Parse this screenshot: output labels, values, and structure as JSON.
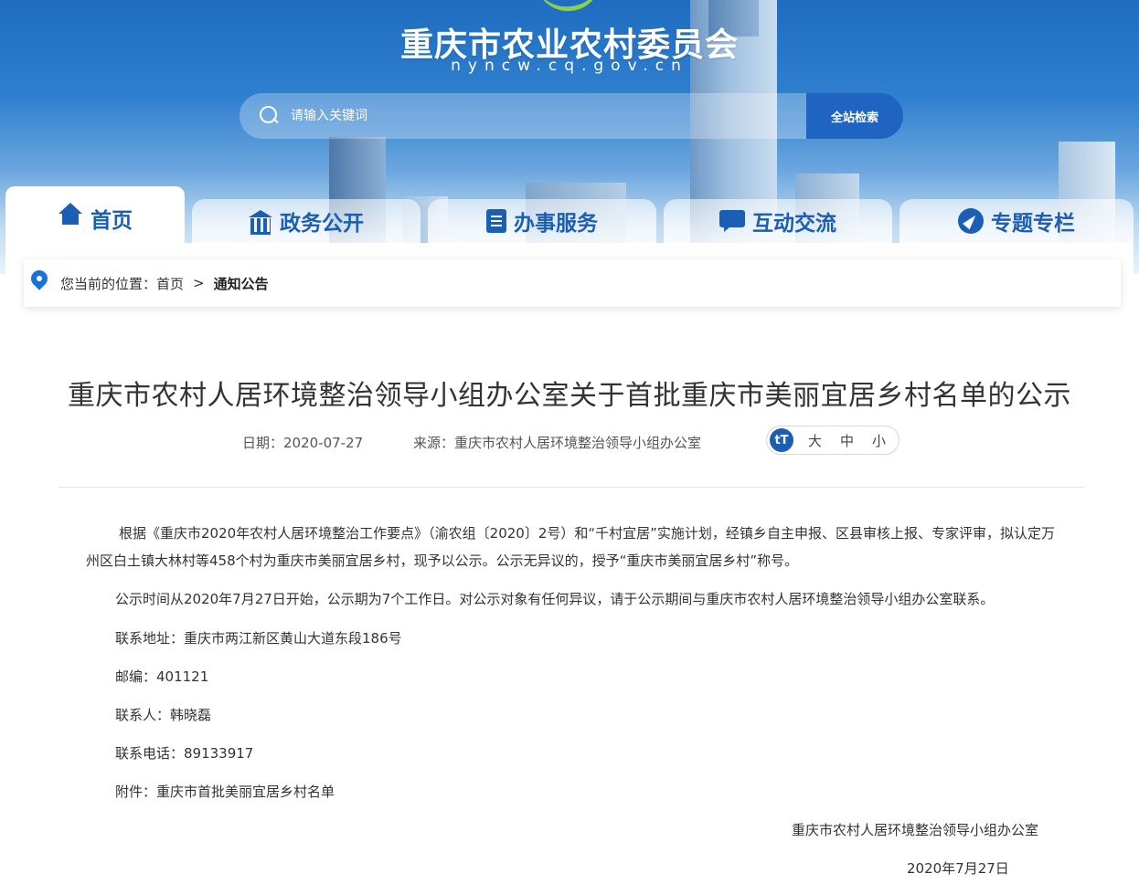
{
  "header": {
    "site_title": "重庆市农业农村委员会",
    "site_domain": "nyncw.cq.gov.cn",
    "search": {
      "placeholder": "请输入关键词",
      "button_label": "全站检索"
    }
  },
  "nav": {
    "items": [
      {
        "label": "首页",
        "icon": "home-icon",
        "active": true
      },
      {
        "label": "政务公开",
        "icon": "government-building-icon",
        "active": false
      },
      {
        "label": "办事服务",
        "icon": "service-checklist-icon",
        "active": false
      },
      {
        "label": "互动交流",
        "icon": "chat-icon",
        "active": false
      },
      {
        "label": "专题专栏",
        "icon": "compass-icon",
        "active": false
      }
    ]
  },
  "breadcrumb": {
    "prefix": "您当前的位置：",
    "home": "首页",
    "separator": ">",
    "current": "通知公告"
  },
  "article": {
    "title": "重庆市农村人居环境整治领导小组办公室关于首批重庆市美丽宜居乡村名单的公示",
    "date": "日期：2020-07-27",
    "source": "来源：重庆市农村人居环境整治领导小组办公室",
    "font_size": {
      "icon_text": "tT",
      "large": "大",
      "medium": "中",
      "small": "小"
    },
    "paragraph_1": "根据《重庆市2020年农村人居环境整治工作要点》（渝农组〔2020〕2号）和“千村宜居”实施计划，经镇乡自主申报、区县审核上报、专家评审，拟认定万州区白土镇大林村等458个村为重庆市美丽宜居乡村，现予以公示。公示无异议的，授予“重庆市美丽宜居乡村”称号。",
    "paragraph_2": "公示时间从2020年7月27日开始，公示期为7个工作日。对公示对象有任何异议，请于公示期间与重庆市农村人居环境整治领导小组办公室联系。",
    "address": "联系地址：重庆市两江新区黄山大道东段186号",
    "postcode": "邮编：401121",
    "contact": "联系人：韩晓磊",
    "phone": "联系电话：89133917",
    "attachment": "附件：重庆市首批美丽宜居乡村名单",
    "signature_org": "重庆市农村人居环境整治领导小组办公室",
    "signature_date": "2020年7月27日"
  },
  "colors": {
    "brand_blue": "#1a5fb4",
    "search_button": "#2064c2"
  }
}
